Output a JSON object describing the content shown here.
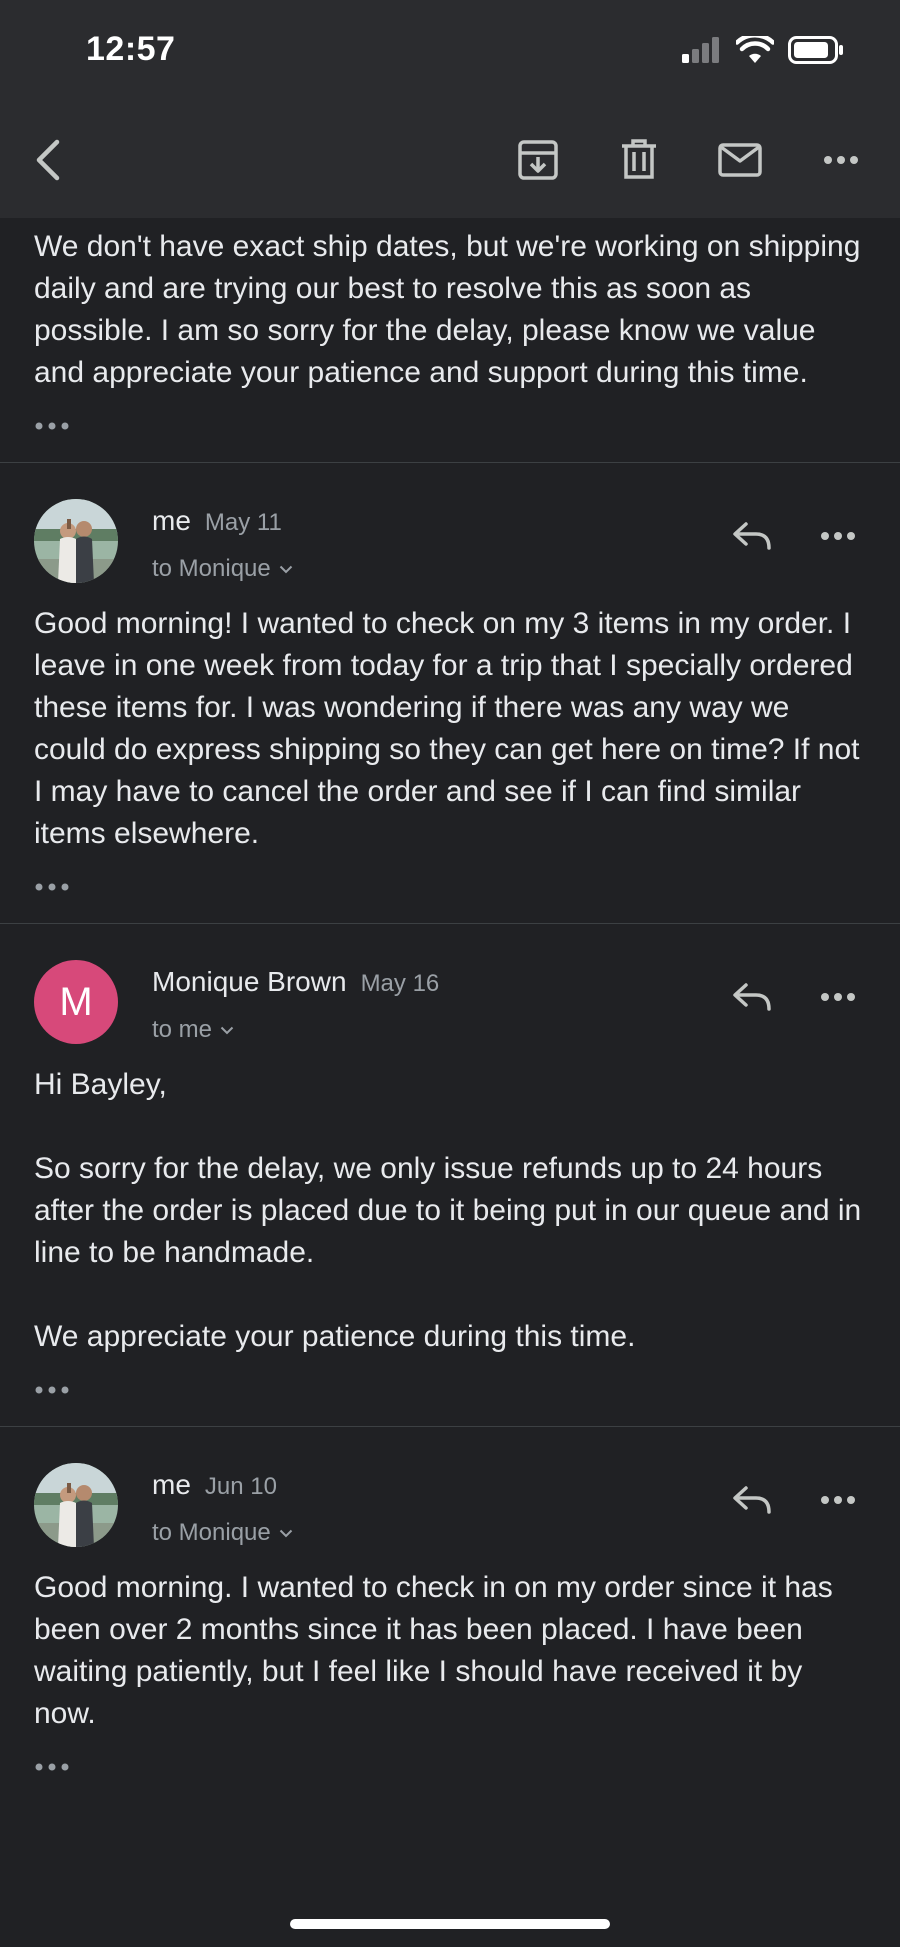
{
  "status_bar": {
    "time": "12:57"
  },
  "toolbar": {
    "icons": [
      "back-icon",
      "archive-icon",
      "trash-icon",
      "mail-icon",
      "more-icon"
    ]
  },
  "thread": {
    "previous_body": "We don't have exact ship dates, but we're working on shipping daily and are trying our best to resolve this as soon as possible. I am so sorry for the delay, please know we value and appreciate your patience and support during this time.",
    "messages": [
      {
        "sender": "me",
        "date": "May 11",
        "recipient": "to Monique",
        "body": "Good morning! I wanted to check on my 3 items in my order. I leave in one week from today for a trip that I specially ordered these items for. I was wondering if there was any way we could do express shipping so they can get here on time? If not I may have to cancel the order and see if I can find similar items elsewhere."
      },
      {
        "sender": "Monique Brown",
        "avatar_letter": "M",
        "avatar_color": "#d7497a",
        "date": "May 16",
        "recipient": "to me",
        "body": "Hi Bayley,\n\nSo sorry for the delay, we only issue refunds up to 24 hours after the order is placed due to it being put in our queue and in line to be handmade.\n\nWe appreciate your patience during this time."
      },
      {
        "sender": "me",
        "date": "Jun 10",
        "recipient": "to Monique",
        "body": "Good morning. I wanted to check in on my order since it has been over 2 months since it has been placed. I have been waiting patiently, but I feel like I should have received it by now."
      }
    ]
  },
  "colors": {
    "background": "#202124",
    "toolbar": "#2b2c2f",
    "text": "#e8eaed",
    "secondary_text": "#9aa0a6",
    "divider": "#3c4043"
  }
}
